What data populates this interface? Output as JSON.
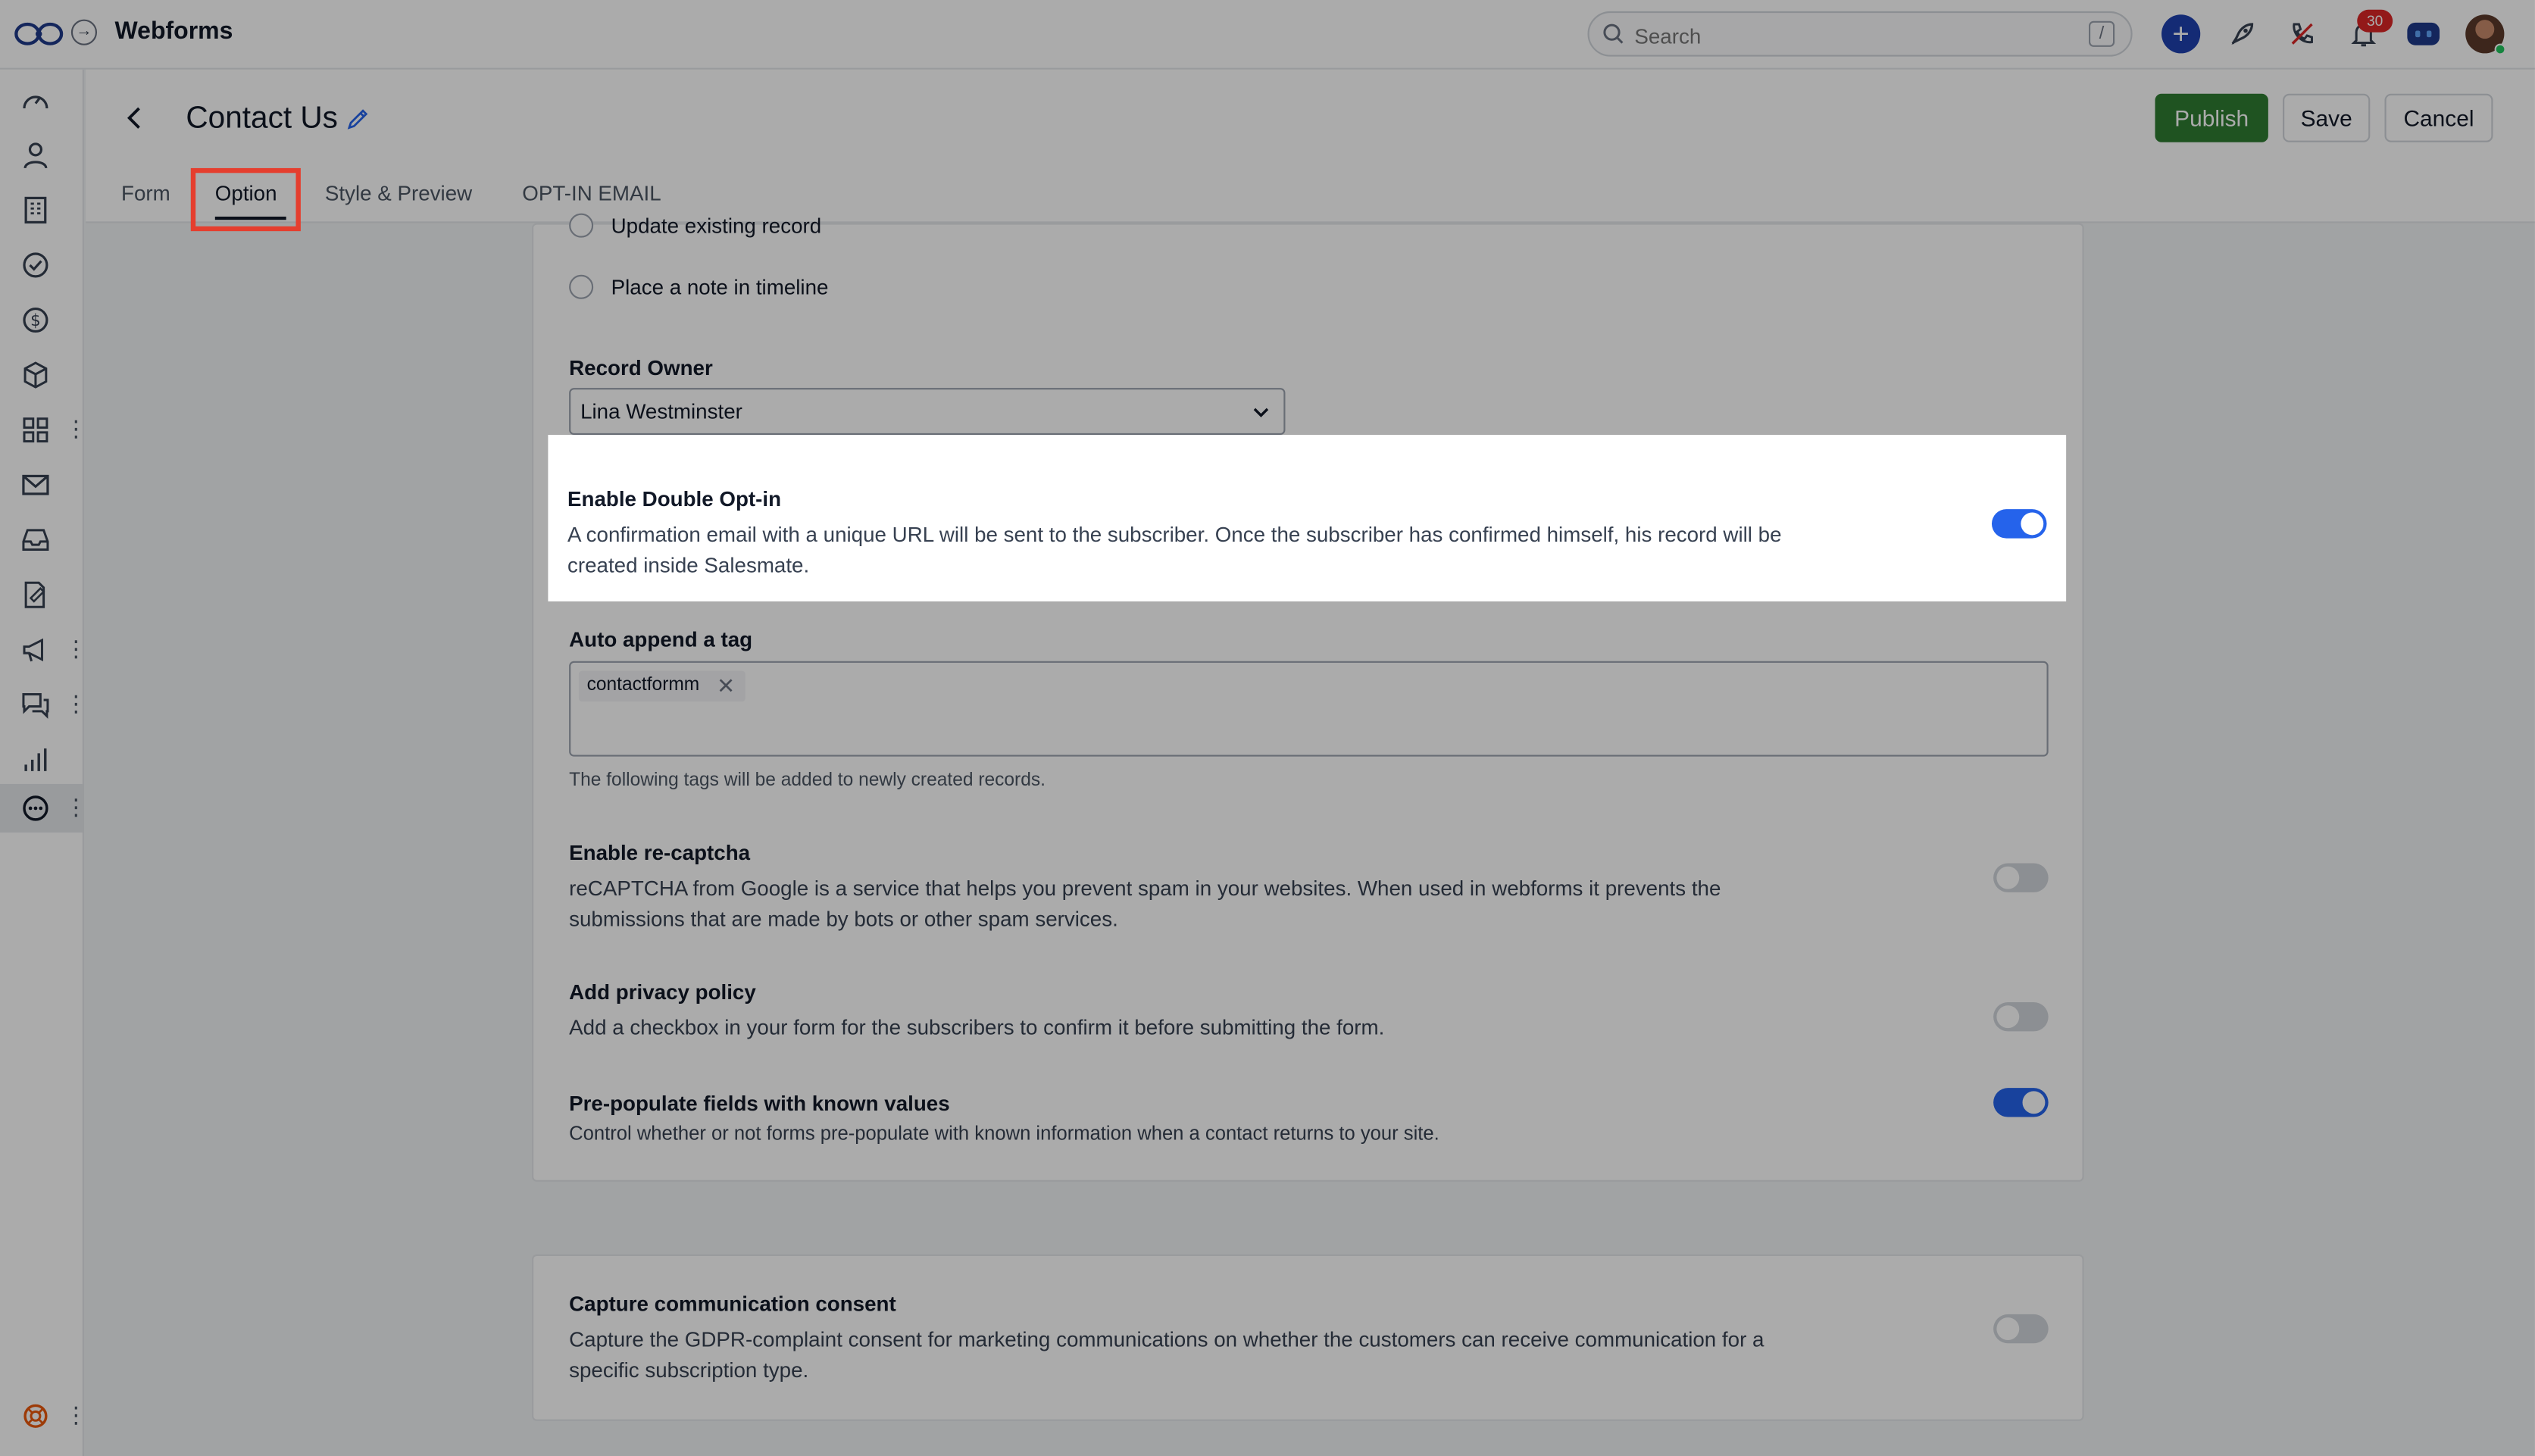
{
  "app": {
    "title": "Webforms"
  },
  "search": {
    "placeholder": "Search",
    "shortcut": "/"
  },
  "notifications": {
    "count": "30"
  },
  "form": {
    "title": "Contact Us"
  },
  "actions": {
    "publish": "Publish",
    "save": "Save",
    "cancel": "Cancel"
  },
  "tabs": [
    {
      "label": "Form",
      "active": false
    },
    {
      "label": "Option",
      "active": true
    },
    {
      "label": "Style & Preview",
      "active": false
    },
    {
      "label": "OPT-IN EMAIL",
      "active": false
    }
  ],
  "options": {
    "existing_record_choices": [
      {
        "label": "Update existing record",
        "selected": false
      },
      {
        "label": "Place a note in timeline",
        "selected": false
      }
    ],
    "record_owner": {
      "label": "Record Owner",
      "value": "Lina Westminster"
    },
    "double_optin": {
      "label": "Enable Double Opt-in",
      "description": "A confirmation email with a unique URL will be sent to the subscriber. Once the subscriber has confirmed himself, his record will be created inside Salesmate.",
      "enabled": true
    },
    "auto_tag": {
      "label": "Auto append a tag",
      "tags": [
        "contactformm"
      ],
      "hint": "The following tags will be added to newly created records."
    },
    "recaptcha": {
      "label": "Enable re-captcha",
      "description": "reCAPTCHA from Google is a service that helps you prevent spam in your websites. When used in webforms it prevents the submissions that are made by bots or other spam services.",
      "enabled": false
    },
    "privacy_policy": {
      "label": "Add privacy policy",
      "description": "Add a checkbox in your form for the subscribers to confirm it before submitting the form.",
      "enabled": false
    },
    "prepopulate": {
      "label": "Pre-populate fields with known values",
      "description": "Control whether or not forms pre-populate with known information when a contact returns to your site.",
      "enabled": true
    }
  },
  "consent": {
    "label": "Capture communication consent",
    "description": "Capture the GDPR-complaint consent for marketing communications on whether the customers can receive communication for a specific subscription type.",
    "enabled": false
  },
  "colors": {
    "primary": "#2563eb",
    "publish": "#2f7d32",
    "highlight_border": "#e53e2e",
    "badge": "#dc2626"
  }
}
